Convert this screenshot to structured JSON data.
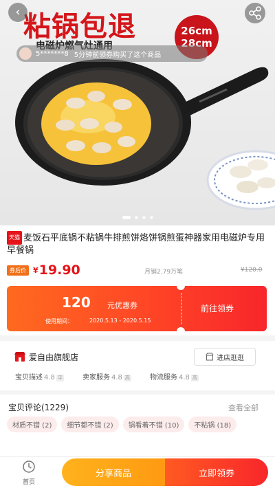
{
  "hero": {
    "title": "粘锅包退",
    "subtitle": "电磁炉燃气灶通用",
    "size_badge": [
      "26cm",
      "28cm"
    ],
    "back_icon": "chevron-left-icon",
    "share_icon": "share-icon",
    "ticker": {
      "user": "5*******8",
      "message": "5分钟前领券购买了这个商品"
    }
  },
  "product": {
    "store_badge": "天猫",
    "title": "麦饭石平底锅不粘锅牛排煎饼烙饼锅煎蛋神器家用电磁炉专用早餐锅",
    "price_label": "券后价",
    "currency": "¥",
    "price": "19.90",
    "sales": "月销2.79万笔",
    "original_price": "¥120.0"
  },
  "coupon": {
    "amount": "120",
    "unit": "元优惠券",
    "date_label": "使用期间：",
    "date_range": "2020.5.13 - 2020.5.15",
    "cta": "前往领券"
  },
  "shop": {
    "name": "爱自由旗舰店",
    "enter_label": "进店逛逛",
    "ratings": [
      {
        "label": "宝贝描述",
        "score": "4.8",
        "level": "平"
      },
      {
        "label": "卖家服务",
        "score": "4.8",
        "level": "高"
      },
      {
        "label": "物流服务",
        "score": "4.8",
        "level": "高"
      }
    ]
  },
  "reviews": {
    "title": "宝贝评论(1229)",
    "view_all": "查看全部",
    "tags": [
      "材质不错 (2)",
      "细节都不错 (2)",
      "锅看着不错 (10)",
      "不粘锅 (18)"
    ]
  },
  "bottom_bar": {
    "home_label": "首页",
    "share_label": "分享商品",
    "claim_label": "立即领券"
  },
  "colors": {
    "accent": "#e4151b",
    "coupon_start": "#ff6a1f",
    "coupon_end": "#f8262b",
    "share_btn": "#ffa516"
  }
}
